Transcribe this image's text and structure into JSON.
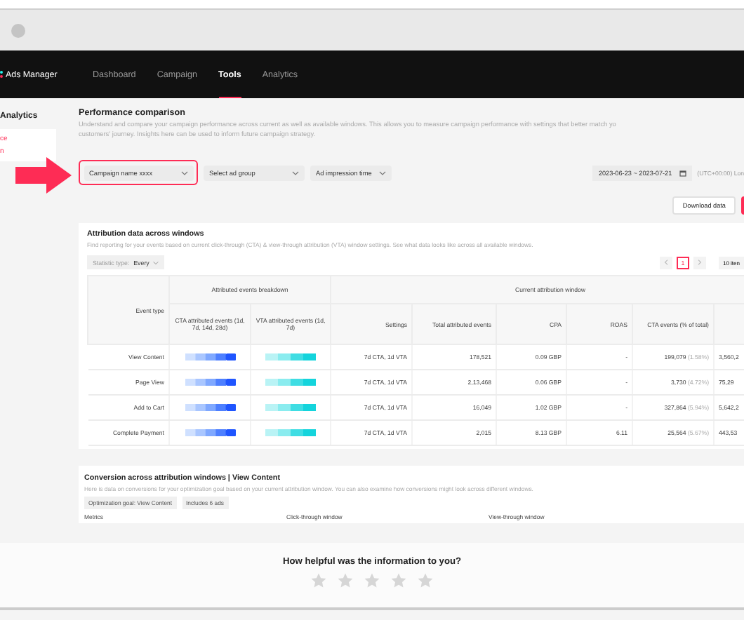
{
  "nav": {
    "logo": "Ads Manager",
    "tabs": [
      {
        "label": "Dashboard",
        "selected": false
      },
      {
        "label": "Campaign",
        "selected": false
      },
      {
        "label": "Tools",
        "selected": true
      },
      {
        "label": "Analytics",
        "selected": false
      }
    ]
  },
  "sidebar": {
    "title": "Analytics",
    "items": [
      {
        "label": "ce"
      },
      {
        "label": "n"
      }
    ]
  },
  "page": {
    "title": "Performance comparison",
    "description": [
      "Understand and compare your campaign performance across current as well as available windows. This allows you to measure campaign performance with settings that better match yo",
      "customers' journey. Insights here can be used to inform future campaign strategy."
    ]
  },
  "filters": [
    {
      "value": "Campaign name xxxx",
      "highlighted": true
    },
    {
      "value": "Select ad group",
      "highlighted": false
    },
    {
      "value": "Ad impression time",
      "highlighted": false
    }
  ],
  "date_range": "2023-06-23 ~ 2023-07-21",
  "timezone": "(UTC+00:00) Lon",
  "download_button": "Download data",
  "attribution": {
    "title": "Attribution data across windows",
    "description": "Find reporting for your events based on current click-through (CTA) & view-through attribution (VTA) window settings. See what data looks like across all available windows.",
    "statistic_type": {
      "label": "Statistic type:",
      "value": "Every"
    },
    "pages": [
      {
        "label": "1",
        "selected": true
      }
    ],
    "page_size": "10 iten",
    "group_headers": [
      "Attributed events breakdown",
      "Current attribution window"
    ],
    "columns": [
      "Event type",
      "CTA attributed events (1d, 7d, 14d, 28d)",
      "VTA attributed events (1d, 7d)",
      "Settings",
      "Total attributed events",
      "CPA",
      "ROAS",
      "CTA events (% of total)"
    ],
    "rows": [
      {
        "event_type": "View Content",
        "settings": "7d CTA, 1d VTA",
        "total": "178,521",
        "cpa": "0.09 GBP",
        "roas": "-",
        "cta_events": "199,079",
        "cta_share": "(1.58%)",
        "column_9": "3,560,2"
      },
      {
        "event_type": "Page View",
        "settings": "7d CTA, 1d VTA",
        "total": "2,13,468",
        "cpa": "0.06 GBP",
        "roas": "-",
        "cta_events": "3,730",
        "cta_share": "(4.72%)",
        "column_9": "75,29"
      },
      {
        "event_type": "Add to Cart",
        "settings": "7d CTA, 1d VTA",
        "total": "16,049",
        "cpa": "1.02 GBP",
        "roas": "-",
        "cta_events": "327,864",
        "cta_share": "(5.94%)",
        "column_9": "5,642,2"
      },
      {
        "event_type": "Complete Payment",
        "settings": "7d CTA, 1d VTA",
        "total": "2,015",
        "cpa": "8.13 GBP",
        "roas": "6.11",
        "cta_events": "25,564",
        "cta_share": "(5.67%)",
        "column_9": "443,53"
      }
    ]
  },
  "conversion": {
    "title": "Conversion across attribution windows | View Content",
    "description": "Here is data on conversions for your optimization goal based on your current attribution window. You can also examine how conversions might look across different windows.",
    "chips": [
      "Optimization goal: View Content",
      "Includes 6 ads"
    ],
    "columns": [
      "Metrics",
      "Click-through window",
      "View-through window"
    ]
  },
  "feedback": {
    "question": "How helpful was the information to you?",
    "stars": 0
  }
}
